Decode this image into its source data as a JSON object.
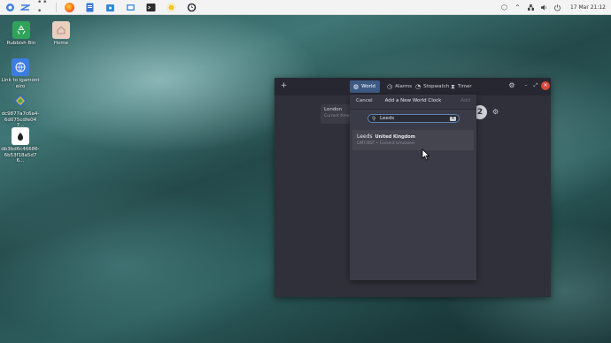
{
  "topbar": {
    "clock": "17 Mar 21:12"
  },
  "desktop": {
    "icons": [
      {
        "label": "Rubbish Bin"
      },
      {
        "label": "Home"
      },
      {
        "label": "Link to igamonteiro"
      },
      {
        "label": "dc9877a7c6a4-6d075cdfe047..."
      },
      {
        "label": "db3bd6c46686-6b53f18a5d76..."
      }
    ]
  },
  "clocks": {
    "tabs": [
      {
        "label": "World"
      },
      {
        "label": "Alarms"
      },
      {
        "label": "Stopwatch"
      },
      {
        "label": "Timer"
      }
    ],
    "background": {
      "city": "London",
      "sub": "Current timez",
      "time_fragment": "2"
    }
  },
  "dialog": {
    "cancel": "Cancel",
    "title": "Add a New World Clock",
    "add": "Add",
    "search": {
      "value": "Leeds",
      "placeholder": ""
    },
    "results": [
      {
        "city": "Leeds",
        "country": "United Kingdom",
        "sub": "GMT/BST • Current timezone"
      }
    ]
  },
  "colors": {
    "window_bg": "#2f3039",
    "tab_active": "#3c5a84",
    "close_button": "#d64a3a"
  }
}
